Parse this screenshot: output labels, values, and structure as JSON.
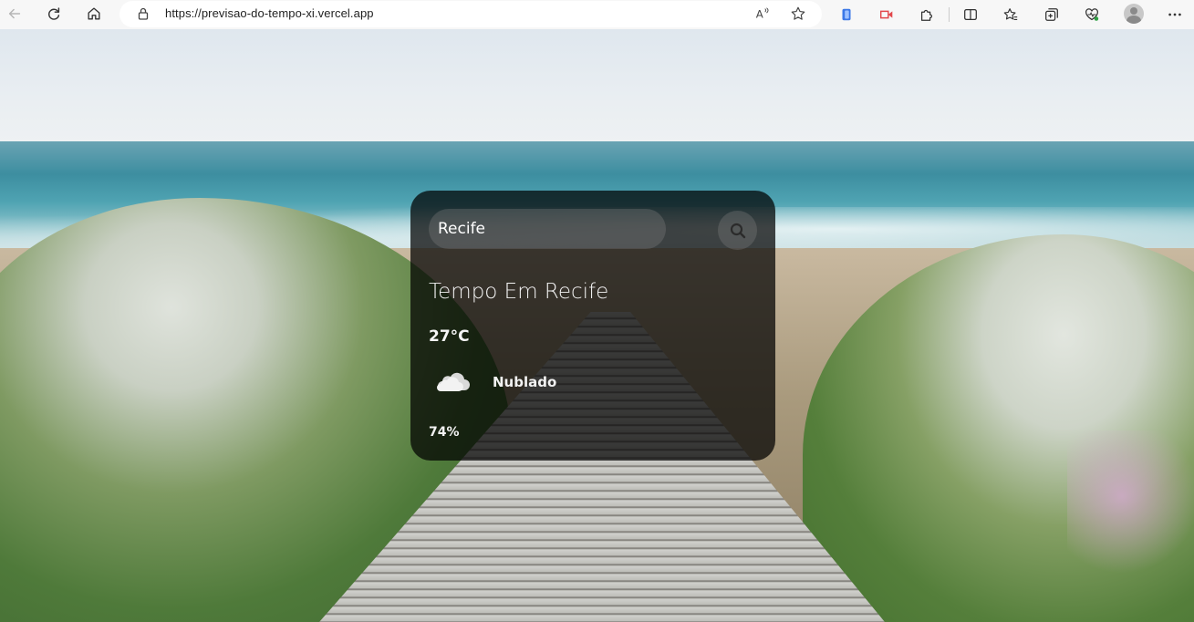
{
  "browser": {
    "url": "https://previsao-do-tempo-xi.vercel.app",
    "icons": {
      "back": "back-arrow-icon",
      "reload": "reload-icon",
      "home": "home-icon",
      "lock": "lock-icon",
      "read_aloud": "read-aloud-icon",
      "favorite": "star-icon",
      "extensions": "puzzle-icon",
      "split_screen": "split-screen-icon",
      "favorites": "favorites-icon",
      "collections": "collections-icon",
      "performance": "heart-pulse-icon",
      "profile": "profile-avatar",
      "more": "more-icon"
    }
  },
  "weather": {
    "search_value": "Recife",
    "title": "Tempo Em Recife",
    "temperature": "27°C",
    "condition": "Nublado",
    "condition_icon": "cloud-icon",
    "humidity": "74%"
  }
}
